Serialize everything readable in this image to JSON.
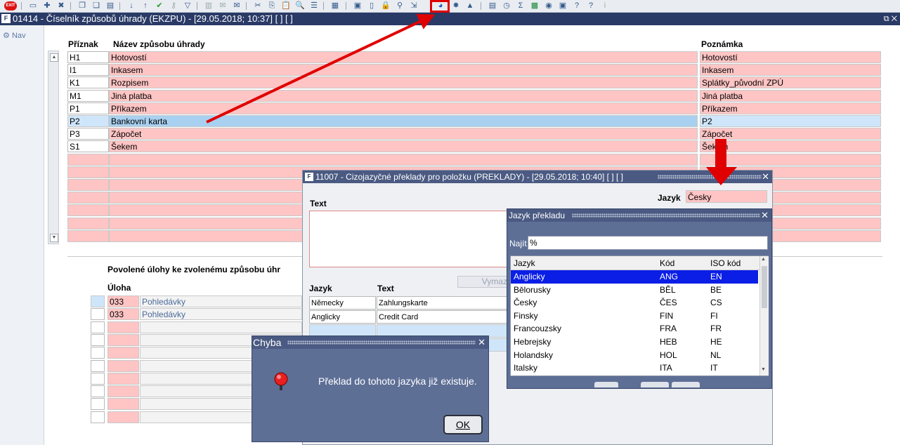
{
  "toolbar": {
    "exit_label": "EXIT"
  },
  "window": {
    "title": "01414 - Číselník způsobů úhrady (EKZPU) - [29.05.2018; 10:37]  [ ]  [ ]",
    "nav_label": "Nav"
  },
  "main_table": {
    "col_code": "Příznak",
    "col_name": "Název způsobu úhrady",
    "col_note": "Poznámka",
    "rows": [
      {
        "code": "H1",
        "name": "Hotovostí",
        "note": "Hotovostí"
      },
      {
        "code": "I1",
        "name": "Inkasem",
        "note": "Inkasem"
      },
      {
        "code": "K1",
        "name": "Rozpisem",
        "note": "Splátky_původní ZPÚ"
      },
      {
        "code": "M1",
        "name": "Jiná platba",
        "note": "Jiná platba"
      },
      {
        "code": "P1",
        "name": "Příkazem",
        "note": "Příkazem"
      },
      {
        "code": "P2",
        "name": "Bankovní karta",
        "note": "P2"
      },
      {
        "code": "P3",
        "name": "Zápočet",
        "note": "Zápočet"
      },
      {
        "code": "S1",
        "name": "Šekem",
        "note": "Šekem"
      }
    ]
  },
  "tasks": {
    "heading": "Povolené úlohy ke zvolenému způsobu úhr",
    "col_task": "Úloha",
    "rows": [
      {
        "code": "033",
        "name": "Pohledávky"
      },
      {
        "code": "033",
        "name": "Pohledávky"
      }
    ]
  },
  "preklady_dialog": {
    "title": "11007 - Cizojazyčné překlady pro položku (PREKLADY) - [29.05.2018; 10:40]  [ ]  [ ]",
    "text_label": "Text",
    "jazyk_label": "Jazyk",
    "jazyk_value": "Česky",
    "delete_button": "Vymaz",
    "col_jazyk": "Jazyk",
    "col_text": "Text",
    "rows": [
      {
        "jazyk": "Německy",
        "text": "Zahlungskarte"
      },
      {
        "jazyk": "Anglicky",
        "text": "Credit Card"
      }
    ]
  },
  "jazyk_dialog": {
    "title": "Jazyk překladu",
    "find_label": "Najít",
    "find_value": "%",
    "col_jazyk": "Jazyk",
    "col_kod": "Kód",
    "col_iso": "ISO kód",
    "rows": [
      {
        "jazyk": "Anglicky",
        "kod": "ANG",
        "iso": "EN"
      },
      {
        "jazyk": "Bělorusky",
        "kod": "BĚL",
        "iso": "BE"
      },
      {
        "jazyk": "Česky",
        "kod": "ČES",
        "iso": "CS"
      },
      {
        "jazyk": "Finsky",
        "kod": "FIN",
        "iso": "FI"
      },
      {
        "jazyk": "Francouzsky",
        "kod": "FRA",
        "iso": "FR"
      },
      {
        "jazyk": "Hebrejsky",
        "kod": "HEB",
        "iso": "HE"
      },
      {
        "jazyk": "Holandsky",
        "kod": "HOL",
        "iso": "NL"
      },
      {
        "jazyk": "Italsky",
        "kod": "ITA",
        "iso": "IT"
      }
    ]
  },
  "error_dialog": {
    "title": "Chyba",
    "message": "Překlad do tohoto jazyka již existuje.",
    "ok_label": "OK"
  },
  "colors": {
    "title_bar": "#2a3a66",
    "required_field": "#ffc4c4",
    "selected_row": "#0a1ee6",
    "annotation": "#e00000"
  }
}
